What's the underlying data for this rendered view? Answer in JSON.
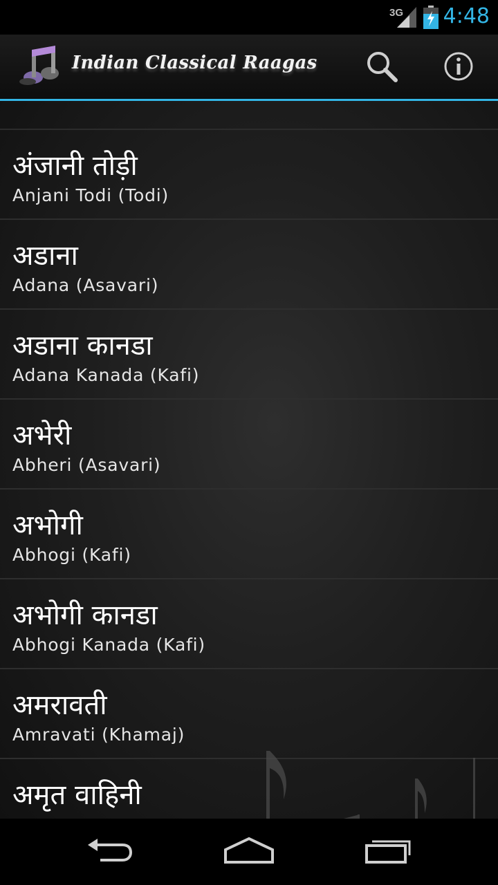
{
  "status_bar": {
    "network": "3G",
    "time": "4:48",
    "icons": [
      "signal-icon",
      "battery-charging-icon"
    ],
    "clock_color": "#33b5e5"
  },
  "action_bar": {
    "title": "Indian Classical Raagas",
    "app_icon": "music-notes-icon",
    "actions": [
      "search-icon",
      "info-icon"
    ],
    "divider_color": "#33b5e5"
  },
  "raagas": [
    {
      "hindi": "अंजानी तोड़ी",
      "english": "Anjani Todi (Todi)"
    },
    {
      "hindi": "अडाना",
      "english": "Adana (Asavari)"
    },
    {
      "hindi": "अडाना कानडा",
      "english": "Adana Kanada (Kafi)"
    },
    {
      "hindi": "अभेरी",
      "english": "Abheri (Asavari)"
    },
    {
      "hindi": "अभोगी",
      "english": "Abhogi (Kafi)"
    },
    {
      "hindi": "अभोगी कानडा",
      "english": "Abhogi Kanada (Kafi)"
    },
    {
      "hindi": "अमरावती",
      "english": "Amravati (Khamaj)"
    },
    {
      "hindi": "अमृत वाहिनी",
      "english": ""
    }
  ],
  "nav_bar": {
    "buttons": [
      "back-icon",
      "home-icon",
      "recents-icon"
    ]
  }
}
